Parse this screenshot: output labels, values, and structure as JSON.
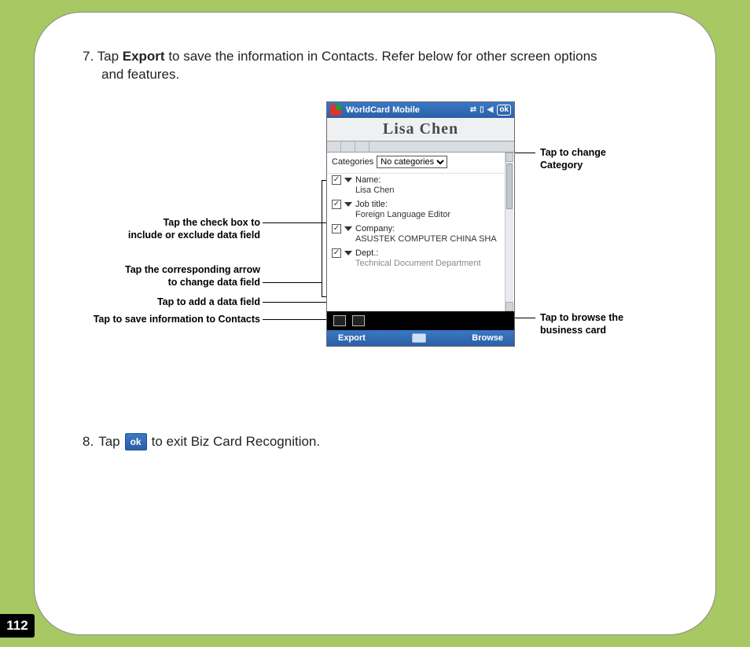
{
  "page_number": "112",
  "step7": {
    "number": "7.",
    "pre": "Tap ",
    "bold": "Export",
    "post": " to save the information in Contacts. Refer below for other screen options",
    "line2": "and features."
  },
  "step8": {
    "number": "8.",
    "pre": "Tap ",
    "ok_label": "ok",
    "post": " to exit Biz Card Recognition."
  },
  "device": {
    "app_title": "WorldCard Mobile",
    "ok_badge": "ok",
    "contact_name": "Lisa Chen",
    "categories_label": "Categories",
    "categories_value": "No categories",
    "fields": [
      {
        "label": "Name:",
        "value": "Lisa Chen"
      },
      {
        "label": "Job title:",
        "value": "Foreign Language Editor"
      },
      {
        "label": "Company:",
        "value": "ASUSTEK COMPUTER CHINA SHA"
      },
      {
        "label": "Dept.:",
        "value": "Technical Document Department"
      }
    ],
    "softkeys": {
      "left": "Export",
      "right": "Browse"
    }
  },
  "callouts": {
    "category": "Tap to change\nCategory",
    "checkbox_l1": "Tap the check box to",
    "checkbox_l2": "include or exclude data field",
    "arrow_l1": "Tap the corresponding arrow",
    "arrow_l2": "to change data field",
    "addfield": "Tap to add a data field",
    "savecontacts": "Tap to save information to Contacts",
    "browse_l1": "Tap to browse the",
    "browse_l2": "business card"
  }
}
